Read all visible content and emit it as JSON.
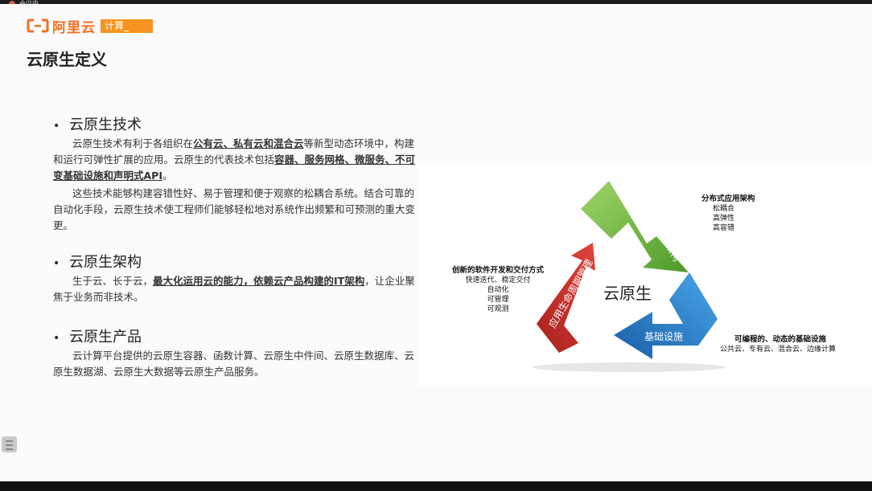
{
  "window": {
    "title": "会议中"
  },
  "brand": {
    "name": "阿里云",
    "tag": "计算_"
  },
  "slide": {
    "title": "云原生定义",
    "sections": [
      {
        "heading": "云原生技术",
        "p1": [
          "云原生技术有利于各组织在",
          "公有云、私有云和混合云",
          "等新型动态环境中，构建和运行可弹性扩展的应用。云原生的代表技术包括",
          "容器、服务网格、微服务、不可变基础设施和声明式API",
          "。"
        ],
        "p2": "这些技术能够构建容错性好、易于管理和便于观察的松耦合系统。结合可靠的自动化手段，云原生技术使工程师们能够轻松地对系统作出频繁和可预测的重大变更。"
      },
      {
        "heading": "云原生架构",
        "p1": [
          "生于云、长于云，",
          "最大化运用云的能力，依赖云产品构建的IT架构",
          "，让企业聚焦于业务而非技术。"
        ]
      },
      {
        "heading": "云原生产品",
        "p1": "云计算平台提供的云原生容器、函数计算、云原生中件间、云原生数据库、云原生数据湖、云原生大数据等云原生产品服务。"
      }
    ]
  },
  "diagram": {
    "center": "云原生",
    "arrows": {
      "top": "应用架构",
      "bottom": "基础设施",
      "left": "应用生命周期管理"
    },
    "right_label": {
      "title": "分布式应用架构",
      "items": [
        "松耦合",
        "高弹性",
        "高容错"
      ]
    },
    "left_label": {
      "title": "创新的软件开发和交付方式",
      "items": [
        "快速迭代、稳定交付",
        "自动化",
        "可管理",
        "可观测"
      ]
    },
    "bottom_label": {
      "title": "可编程的、动态的基础设施",
      "items": [
        "公共云、专有云、混合云、边缘计算"
      ]
    },
    "colors": {
      "green": "#7cc242",
      "blue": "#2a86d0",
      "red": "#c8332e"
    }
  }
}
